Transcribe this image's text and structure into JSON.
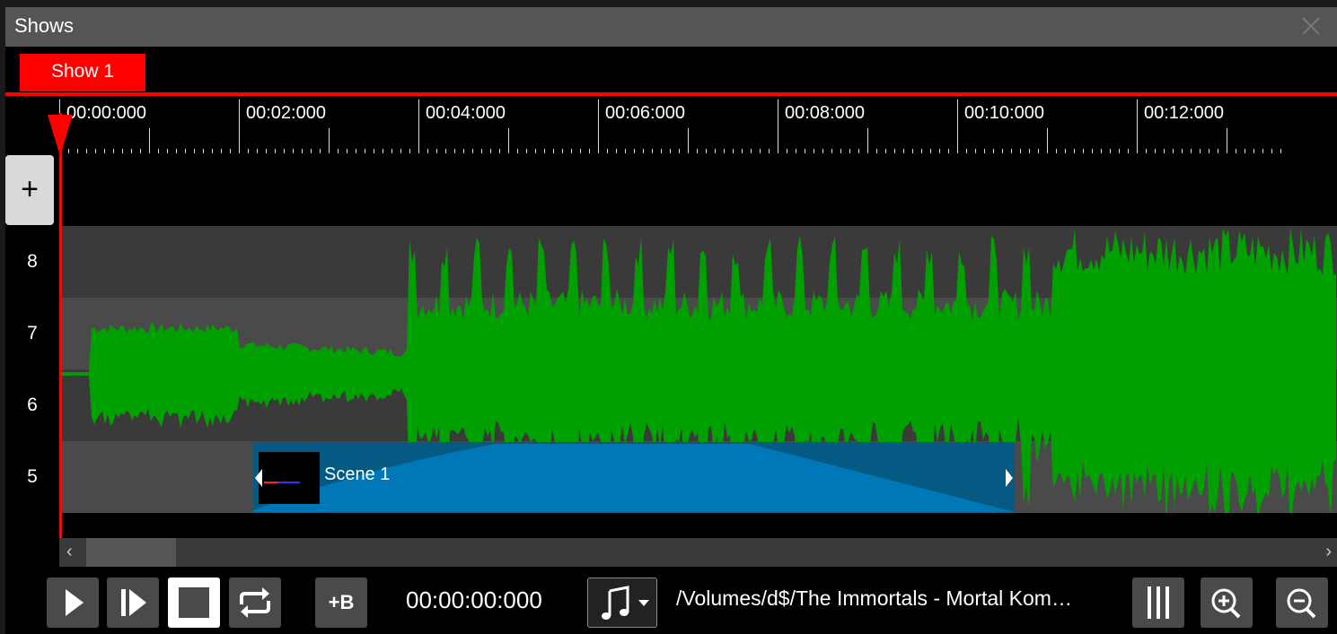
{
  "window": {
    "title": "Shows",
    "close_icon": "close-icon"
  },
  "tabs": [
    {
      "label": "Show 1",
      "active": true,
      "color": "#ff0000"
    }
  ],
  "ruler": {
    "labels": [
      "00:00:000",
      "00:02:000",
      "00:04:000",
      "00:06:000",
      "00:08:000",
      "00:10:000",
      "00:12:000"
    ]
  },
  "tracks": {
    "add_label": "+",
    "lanes": [
      "8",
      "7",
      "6",
      "5"
    ],
    "waveform_color": "#00a000"
  },
  "scene": {
    "label": "Scene 1",
    "color": "#0077b6"
  },
  "playhead": {
    "color": "#ff0000"
  },
  "transport": {
    "buttons": [
      "play-icon",
      "play-from-icon",
      "stop-icon",
      "loop-icon"
    ],
    "boost_label": "+B",
    "time": "00:00:00:000",
    "media_icon": "music-note-icon",
    "file_path": "/Volumes/d$/The Immortals - Mortal Kom…",
    "right_buttons": [
      "columns-icon",
      "zoom-in-icon",
      "zoom-out-icon"
    ]
  }
}
